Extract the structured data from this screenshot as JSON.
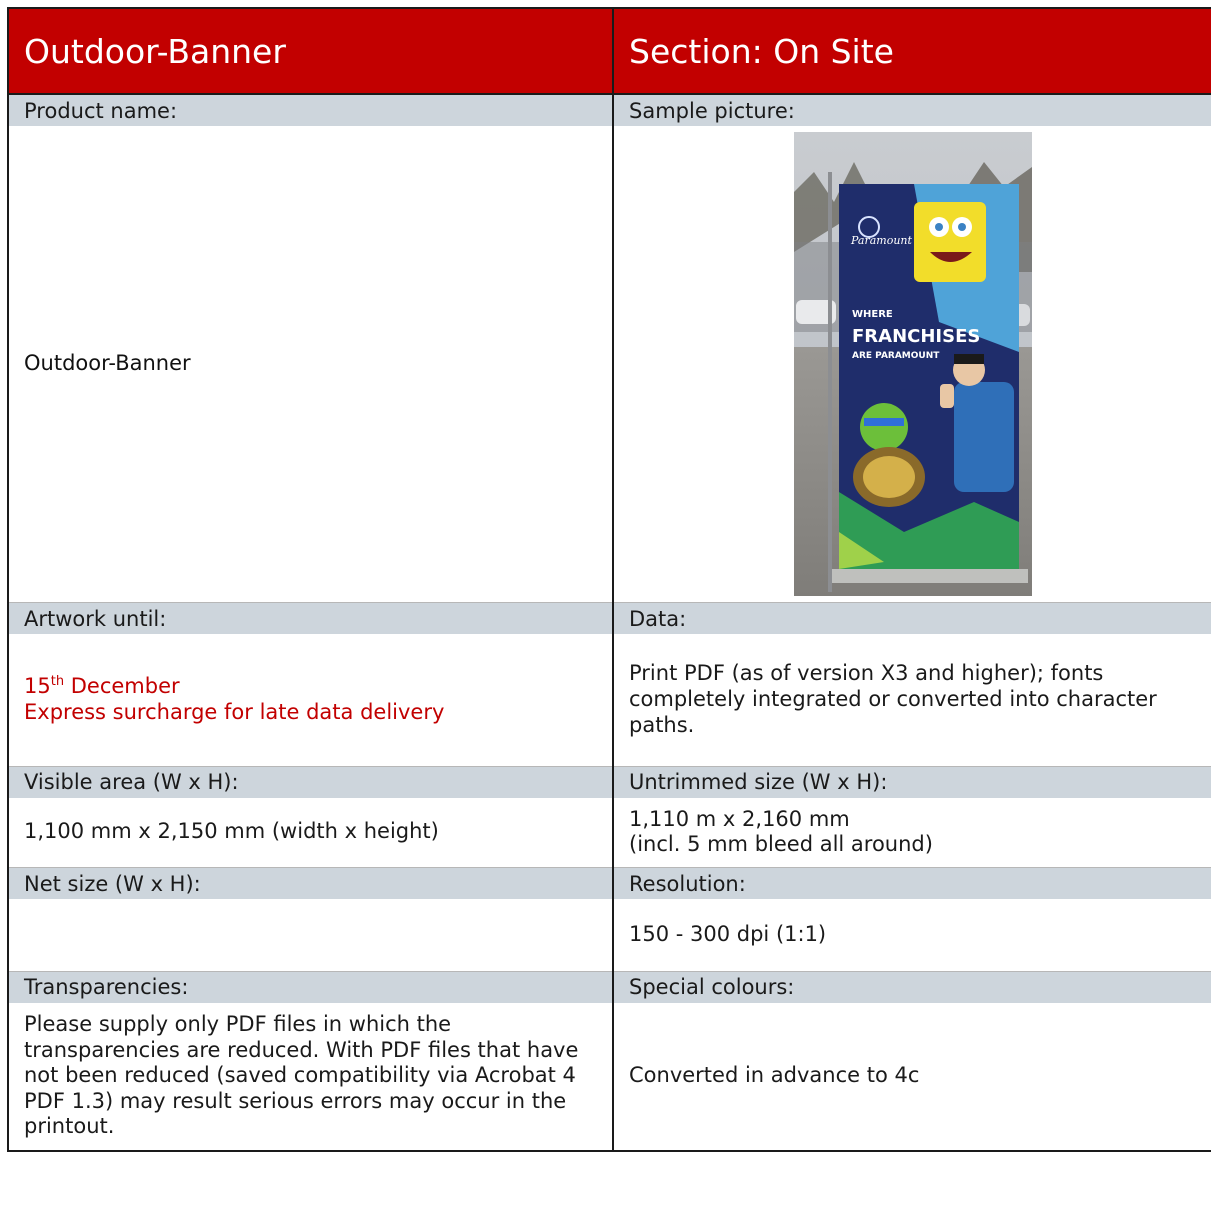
{
  "header": {
    "title": "Outdoor-Banner",
    "section": "Section: On Site"
  },
  "product": {
    "label": "Product name:",
    "value": "Outdoor-Banner"
  },
  "sample": {
    "label": "Sample picture:",
    "photo": {
      "logo_text": "Paramount",
      "headline_line1": "WHERE",
      "headline_line2": "FRANCHISES",
      "headline_line3": "ARE PARAMOUNT"
    }
  },
  "artwork": {
    "label": "Artwork until:",
    "day": "15",
    "day_suffix": "th",
    "month": " December",
    "note": "Express surcharge for late data delivery",
    "color": "#c20000"
  },
  "data": {
    "label": "Data:",
    "value": "Print PDF (as of version X3 and higher); fonts completely integrated or converted into character paths."
  },
  "visible_area": {
    "label": "Visible area (W x H):",
    "value": "1,100 mm x 2,150 mm (width x height)"
  },
  "untrimmed": {
    "label": "Untrimmed size (W x H):",
    "line1": "1,110 m x 2,160 mm",
    "line2": "(incl. 5 mm bleed all around)"
  },
  "net_size": {
    "label": "Net size (W x H):",
    "value": ""
  },
  "resolution": {
    "label": "Resolution:",
    "value": "150 - 300 dpi (1:1)"
  },
  "transparencies": {
    "label": "Transparencies:",
    "value": "Please supply only PDF files in which the transparencies are reduced. With PDF files that have not been reduced (saved compatibility via Acrobat 4 PDF 1.3) may result serious errors may occur in the printout."
  },
  "special_colours": {
    "label": "Special colours:",
    "value": "Converted in advance to 4c"
  },
  "colors": {
    "brand_red": "#c20000",
    "label_band": "#cdd5dc"
  }
}
